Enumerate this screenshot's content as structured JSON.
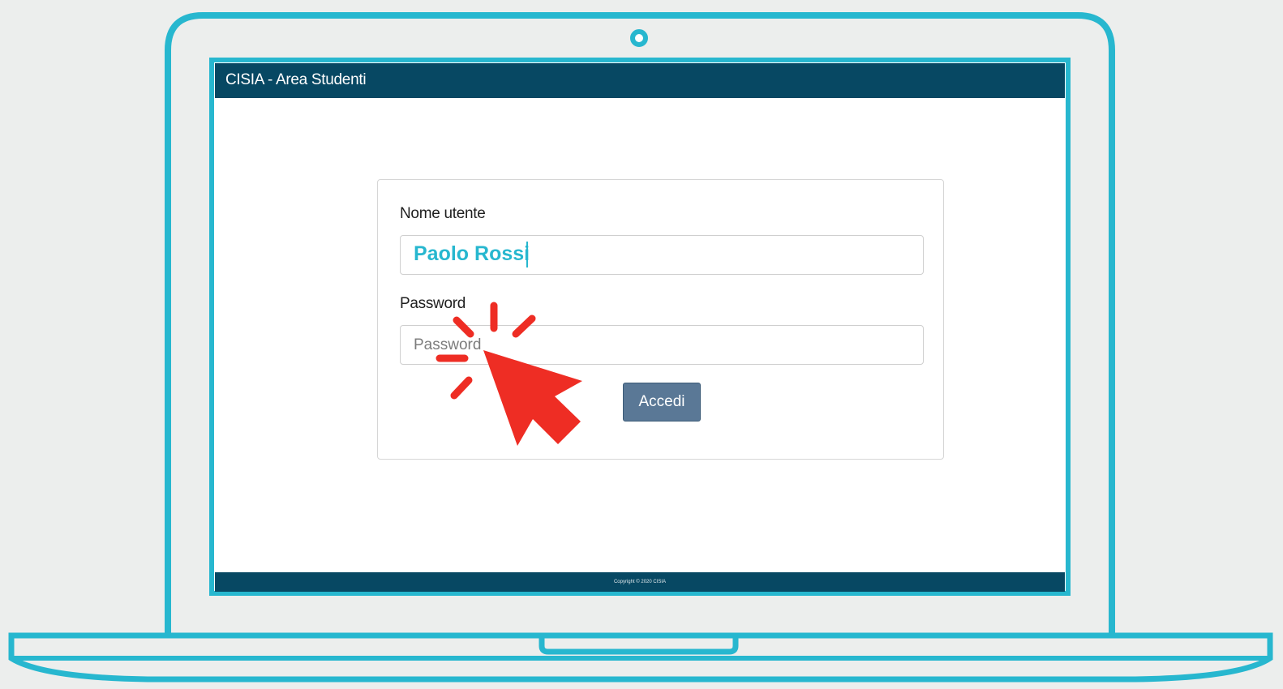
{
  "header": {
    "title": "CISIA - Area Studenti"
  },
  "login": {
    "username_label": "Nome utente",
    "username_value": "Paolo Rossi",
    "password_label": "Password",
    "password_placeholder": "Password",
    "submit_label": "Accedi"
  },
  "footer": {
    "copyright": "Copyright © 2020 CISIA"
  },
  "colors": {
    "frame": "#27b7cf",
    "header_bg": "#074863",
    "button_bg": "#5a7896",
    "cursor": "#ee2d24",
    "background": "#eceeed"
  },
  "icons": [
    "webcam-icon",
    "click-cursor-icon"
  ]
}
